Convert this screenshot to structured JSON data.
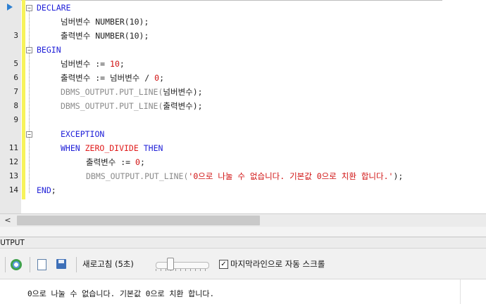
{
  "editor": {
    "lines": [
      {
        "no": "",
        "tokens": [
          {
            "t": "DECLARE",
            "c": "kw"
          }
        ]
      },
      {
        "no": "",
        "tokens": [
          {
            "t": "넘버변수 ",
            "c": "op"
          },
          {
            "t": "NUMBER(10);",
            "c": "op"
          }
        ]
      },
      {
        "no": "3",
        "tokens": [
          {
            "t": "출력변수 ",
            "c": "op"
          },
          {
            "t": "NUMBER(10);",
            "c": "op"
          }
        ]
      },
      {
        "no": "",
        "tokens": [
          {
            "t": "BEGIN",
            "c": "kw"
          }
        ]
      },
      {
        "no": "5",
        "tokens": [
          {
            "t": "넘버변수 ",
            "c": "op"
          },
          {
            "t": ":= ",
            "c": "op"
          },
          {
            "t": "10",
            "c": "str"
          },
          {
            "t": ";",
            "c": "op"
          }
        ]
      },
      {
        "no": "6",
        "tokens": [
          {
            "t": "출력변수 ",
            "c": "op"
          },
          {
            "t": ":= ",
            "c": "op"
          },
          {
            "t": "넘버변수 / ",
            "c": "op"
          },
          {
            "t": "0",
            "c": "str"
          },
          {
            "t": ";",
            "c": "op"
          }
        ]
      },
      {
        "no": "7",
        "tokens": [
          {
            "t": "DBMS_OUTPUT.PUT_LINE(",
            "c": "fn"
          },
          {
            "t": "넘버변수",
            "c": "op"
          },
          {
            "t": ");",
            "c": "op"
          }
        ]
      },
      {
        "no": "8",
        "tokens": [
          {
            "t": "DBMS_OUTPUT.PUT_LINE(",
            "c": "fn"
          },
          {
            "t": "출력변수",
            "c": "op"
          },
          {
            "t": ");",
            "c": "op"
          }
        ]
      },
      {
        "no": "9",
        "tokens": []
      },
      {
        "no": "",
        "tokens": [
          {
            "t": "EXCEPTION",
            "c": "kw"
          }
        ]
      },
      {
        "no": "11",
        "tokens": [
          {
            "t": "WHEN ",
            "c": "kw"
          },
          {
            "t": "ZERO_DIVIDE",
            "c": "ex"
          },
          {
            "t": " THEN",
            "c": "kw"
          }
        ]
      },
      {
        "no": "12",
        "tokens": [
          {
            "t": "출력변수 ",
            "c": "op"
          },
          {
            "t": ":= ",
            "c": "op"
          },
          {
            "t": "0",
            "c": "str"
          },
          {
            "t": ";",
            "c": "op"
          }
        ]
      },
      {
        "no": "13",
        "tokens": [
          {
            "t": "DBMS_OUTPUT.PUT_LINE(",
            "c": "fn"
          },
          {
            "t": "'0으로 나눌 수 없습니다. 기본값 0으로 치환 합니다.'",
            "c": "str"
          },
          {
            "t": ");",
            "c": "op"
          }
        ]
      },
      {
        "no": "14",
        "tokens": [
          {
            "t": "END",
            "c": "kw"
          },
          {
            "t": ";",
            "c": "op"
          }
        ]
      }
    ]
  },
  "scrollbar": {
    "left_arrow": "<"
  },
  "output": {
    "title": "OUTPUT",
    "refresh_label": "새로고침 (5초)",
    "autoscroll_label": "마지막라인으로 자동 스크롤",
    "autoscroll_checked": "✓",
    "message": "0으로 나눌 수 없습니다. 기본값 0으로 치환 합니다."
  }
}
